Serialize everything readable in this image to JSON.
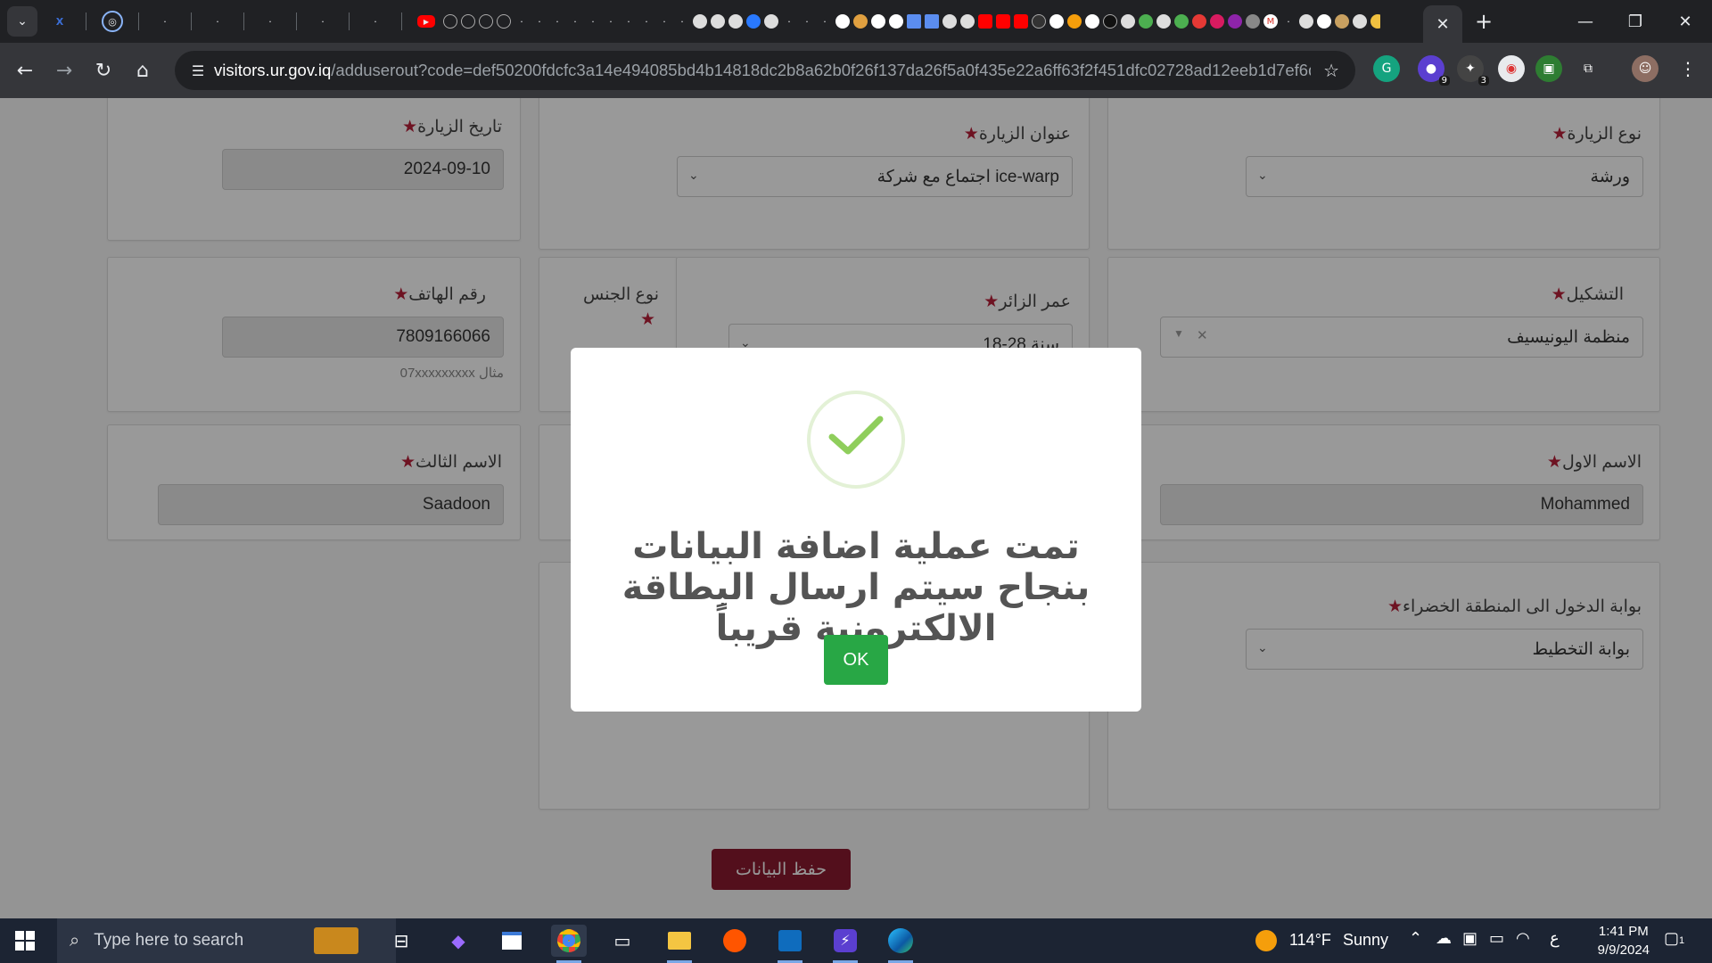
{
  "browser": {
    "url_host": "visitors.ur.gov.iq",
    "url_rest": "/adduserout?code=def50200fdcfc3a14e494085bd4b14818dc2b8a62b0f26f137da26f5a0f435e22a6ff63f2f451dfc02728ad12eeb1d7ef6dd588a...",
    "extension_badges": [
      "9",
      "3"
    ]
  },
  "form": {
    "visit_date_label": "تاريخ الزيارة",
    "visit_date_value": "2024-09-10",
    "visit_title_label": "عنوان الزيارة",
    "visit_title_value": "اجتماع مع شركة ice-warp",
    "visit_type_label": "نوع الزيارة",
    "visit_type_value": "ورشة",
    "phone_label": "رقم الهاتف",
    "phone_value": "7809166066",
    "phone_hint": "مثال 07xxxxxxxxx",
    "gender_label": "نوع الجنس",
    "age_label": "عمر الزائر",
    "age_value": "18-28 سنة",
    "organization_label": "التشكيل",
    "organization_value": "منظمة اليونيسيف",
    "third_name_label": "الاسم الثالث",
    "third_name_value": "Saadoon",
    "first_name_label": "الاسم الاول",
    "first_name_value": "Mohammed",
    "gate_label": "بوابة الدخول الى المنطقة الخضراء",
    "gate_value": "بوابة التخطيط",
    "save_label": "حفظ البيانات"
  },
  "dialog": {
    "message": "تمت عملية اضافة البيانات بنجاح سيتم ارسال البطاقة الالكترونية قريباً",
    "ok_label": "OK"
  },
  "taskbar": {
    "search_placeholder": "Type here to search",
    "weather_temp": "114°F",
    "weather_text": "Sunny",
    "ime": "ع",
    "time": "1:41 PM",
    "date": "9/9/2024",
    "notification_count": "1"
  }
}
